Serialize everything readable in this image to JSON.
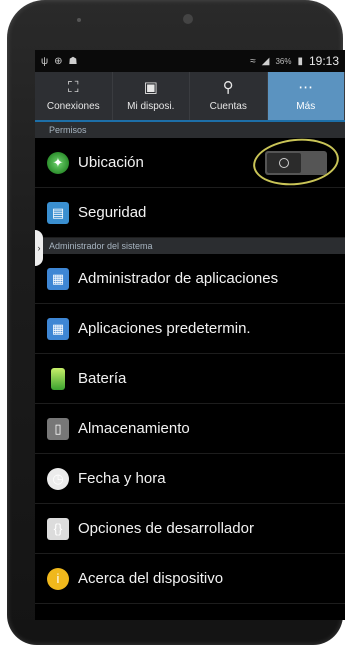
{
  "status_bar": {
    "left_icons": [
      "usb-icon",
      "pin-icon",
      "notification-icon"
    ],
    "right_icons": [
      "wifi-icon",
      "signal-icon"
    ],
    "battery": "36%",
    "time": "19:13"
  },
  "tabs": [
    {
      "label": "Conexiones",
      "icon": "connections-icon"
    },
    {
      "label": "Mi disposi.",
      "icon": "device-icon"
    },
    {
      "label": "Cuentas",
      "icon": "key-icon"
    },
    {
      "label": "Más",
      "icon": "more-icon"
    }
  ],
  "sections": {
    "permisos": "Permisos",
    "admin": "Administrador del sistema"
  },
  "items": {
    "ubicacion": "Ubicación",
    "seguridad": "Seguridad",
    "apps": "Administrador de aplicaciones",
    "default_apps": "Aplicaciones predetermin.",
    "bateria": "Batería",
    "almacenamiento": "Almacenamiento",
    "fecha": "Fecha y hora",
    "desarrollador": "Opciones de desarrollador",
    "acerca": "Acerca del dispositivo"
  },
  "toggle_state": "off",
  "colors": {
    "active_tab": "#5b93c0",
    "tab_underline": "#1d6fa8",
    "annotation_circle": "#c9c457"
  }
}
